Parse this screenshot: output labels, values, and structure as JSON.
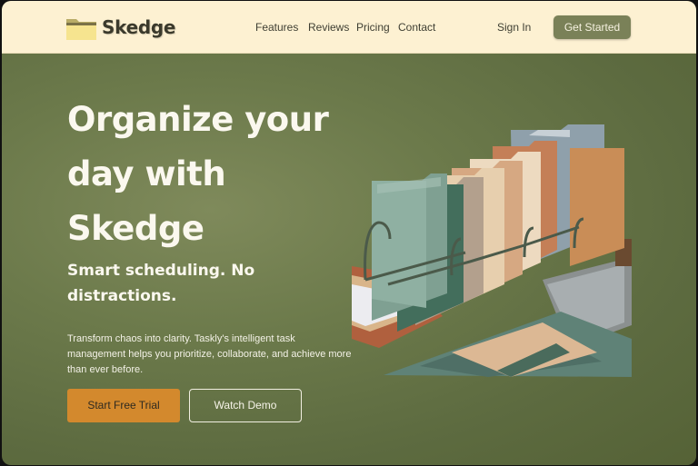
{
  "header": {
    "brand": "Skedge",
    "logo_icon": "folder-icon",
    "nav": [
      "Features",
      "Reviews",
      "Pricing",
      "Contact"
    ],
    "sign_in": "Sign In",
    "cta": "Get Started"
  },
  "hero": {
    "title_lines": [
      "Organize your",
      "day with",
      "Skedge"
    ],
    "subtitle_lines": [
      "Smart scheduling. No",
      "distractions."
    ],
    "description_lines": [
      "Transform chaos into clarity. Taskly's intelligent task",
      "management helps you prioritize, collaborate, and achieve more",
      "than ever before."
    ],
    "primary_button": "Start Free Trial",
    "secondary_button": "Watch Demo",
    "image": "desk-organizer-folders-illustration"
  },
  "colors": {
    "header_bg": "#fdf1d2",
    "hero_bg": "#6c7a4b",
    "accent_orange": "#d3892d",
    "accent_olive": "#7a8158"
  }
}
